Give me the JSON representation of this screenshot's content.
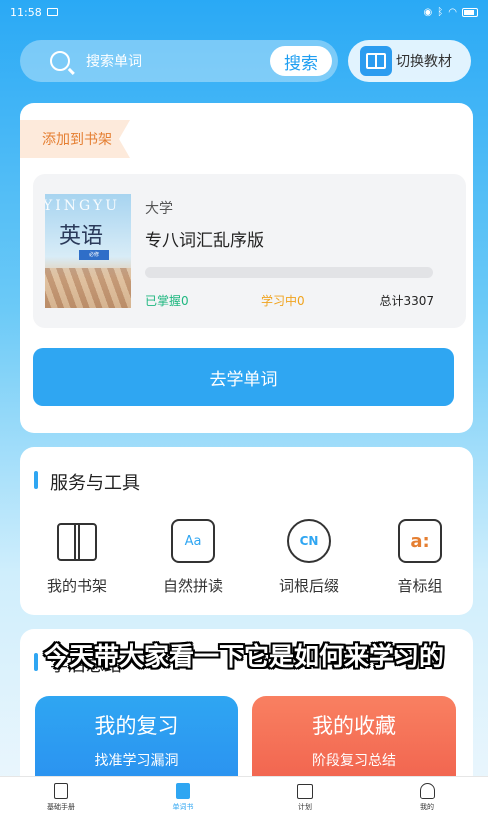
{
  "status_bar": {
    "time": "11:58"
  },
  "search": {
    "placeholder": "搜索单词",
    "button_label": "搜索"
  },
  "switch_textbook": {
    "label": "切换教材"
  },
  "book": {
    "ribbon": "添加到书架",
    "cover_text_en": "YINGYU",
    "cover_text_cn": "英语",
    "cover_badge": "必修",
    "level": "大学",
    "name": "专八词汇乱序版",
    "mastered": "已掌握0",
    "learning": "学习中0",
    "total": "总计3307",
    "progress_fraction": 0,
    "go_learn": "去学单词"
  },
  "tools": {
    "title": "服务与工具",
    "items": [
      {
        "label": "我的书架",
        "icon": "open-book-icon"
      },
      {
        "label": "自然拼读",
        "icon": "aa-card-icon",
        "glyph": "Aa"
      },
      {
        "label": "词根后缀",
        "icon": "cn-circle-icon",
        "glyph": "CN"
      },
      {
        "label": "音标组",
        "icon": "phonetic-icon",
        "glyph": "a:"
      }
    ]
  },
  "summary": {
    "title": "学后总结",
    "review": {
      "title": "我的复习",
      "subtitle": "找准学习漏洞"
    },
    "favorites": {
      "title": "我的收藏",
      "subtitle": "阶段复习总结"
    }
  },
  "caption": "今天带大家看一下它是如何来学习的",
  "tabs": [
    {
      "label": "基础手册",
      "icon": "handbook-icon",
      "active": false
    },
    {
      "label": "单词书",
      "icon": "wordbook-icon",
      "active": true
    },
    {
      "label": "计划",
      "icon": "calendar-icon",
      "active": false
    },
    {
      "label": "我的",
      "icon": "person-icon",
      "active": false
    }
  ],
  "colors": {
    "accent": "#2fa6f2",
    "mastered": "#1fb780",
    "learning": "#f0a31e",
    "favorites": "#f0604c"
  }
}
